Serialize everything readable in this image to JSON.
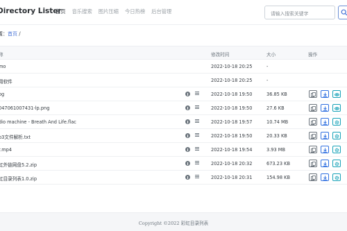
{
  "header": {
    "brand": "Directory Lister",
    "nav": [
      "首页",
      "音乐搜索",
      "图片压缩",
      "今日热榜",
      "后台管理"
    ],
    "active_nav": 0,
    "search_placeholder": "请输入搜索关键字"
  },
  "breadcrumb": {
    "prefix": "置：",
    "home": "首页",
    "separator": "/"
  },
  "table": {
    "columns": [
      "称",
      "修改时间",
      "大小",
      "操作"
    ],
    "rows": [
      {
        "name": "mo",
        "time": "2022-10-18 20:25",
        "size": "-",
        "type": "folder"
      },
      {
        "name": "用软件",
        "time": "2022-10-18 20:25",
        "size": "-",
        "type": "folder"
      },
      {
        "name": "og",
        "time": "2022-10-18 19:50",
        "size": "36.85 KB",
        "type": "file",
        "action3": "eye-icon"
      },
      {
        "name": "047061007431-lp.png",
        "time": "2022-10-18 19:50",
        "size": "27.6 KB",
        "type": "file",
        "action3": "eye-icon"
      },
      {
        "name": "dio machine - Breath And Life.flac",
        "time": "2022-10-18 19:57",
        "size": "10.74 MB",
        "type": "file",
        "action3": "gear-icon"
      },
      {
        "name": "p3文件解析.txt",
        "time": "2022-10-18 19:50",
        "size": "20.33 KB",
        "type": "file",
        "action3": "gear-icon"
      },
      {
        "name": "r.mp4",
        "time": "2022-10-18 19:54",
        "size": "3.93 MB",
        "type": "file",
        "action3": "gear-icon"
      },
      {
        "name": "虹外链网盘5.2.zip",
        "time": "2022-10-18 20:32",
        "size": "673.23 KB",
        "type": "file",
        "action3": "gear-icon"
      },
      {
        "name": "虹目录列表1.0.zip",
        "time": "2022-10-18 20:31",
        "size": "154.98 KB",
        "type": "file",
        "action3": "gear-icon"
      }
    ]
  },
  "footer": {
    "text": "Copyright ©2022 彩虹目录列表"
  },
  "colors": {
    "link": "#4470d6",
    "download": "#2f6fe0",
    "view": "#17a2b8"
  }
}
